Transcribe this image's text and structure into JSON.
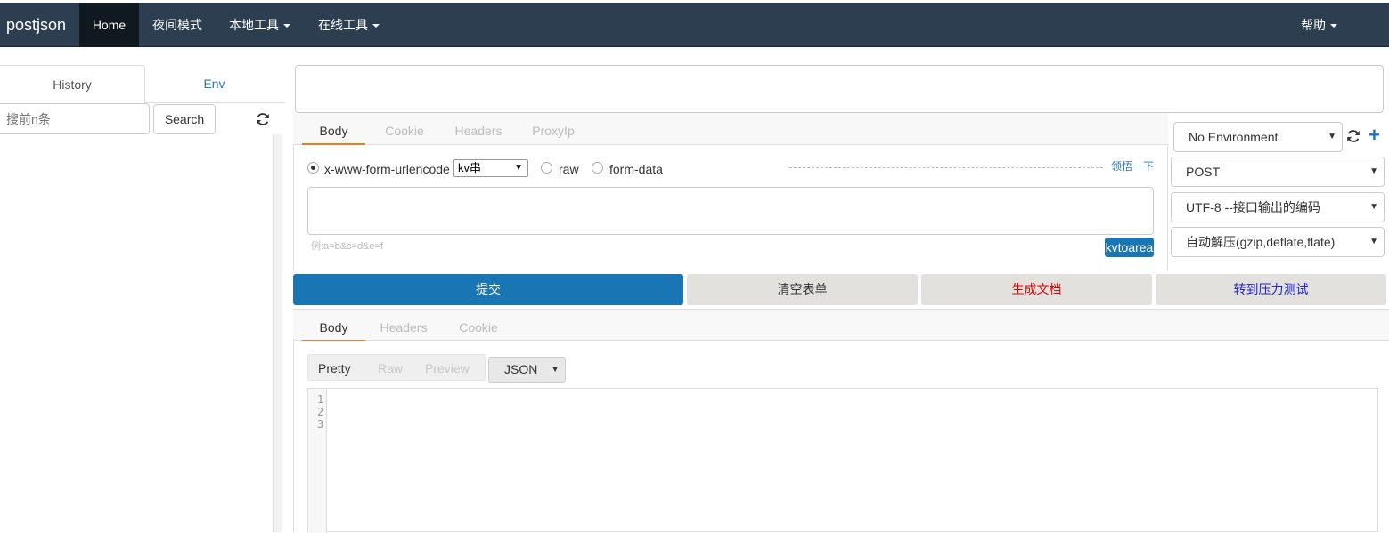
{
  "navbar": {
    "brand": "postjson",
    "items": [
      {
        "label": "Home"
      },
      {
        "label": "夜间模式"
      },
      {
        "label": "本地工具"
      },
      {
        "label": "在线工具"
      }
    ],
    "help": "帮助"
  },
  "left": {
    "tabs": [
      {
        "label": "History"
      },
      {
        "label": "Env"
      }
    ],
    "search_placeholder": "搜前n条",
    "search_button": "Search"
  },
  "request": {
    "tabs": [
      {
        "label": "Body"
      },
      {
        "label": "Cookie"
      },
      {
        "label": "Headers"
      },
      {
        "label": "ProxyIp"
      }
    ],
    "body_types": [
      {
        "label": "x-www-form-urlencode",
        "checked": true
      },
      {
        "label": "raw",
        "checked": false
      },
      {
        "label": "form-data",
        "checked": false
      }
    ],
    "kv_select": "kv串",
    "link": "领悟一下",
    "hint": "例:a=b&c=d&e=f",
    "kvtoarea": "kvtoarea"
  },
  "settings": {
    "environment": "No Environment",
    "method": "POST",
    "encoding": "UTF-8 --接口输出的编码",
    "decompress": "自动解压(gzip,deflate,flate)"
  },
  "actions": {
    "submit": "提交",
    "clear": "清空表单",
    "doc": "生成文档",
    "stress": "转到压力测试"
  },
  "response": {
    "tabs": [
      {
        "label": "Body"
      },
      {
        "label": "Headers"
      },
      {
        "label": "Cookie"
      }
    ],
    "views": [
      {
        "label": "Pretty"
      },
      {
        "label": "Raw"
      },
      {
        "label": "Preview"
      }
    ],
    "format": "JSON",
    "line_numbers": [
      "1",
      "2",
      "3"
    ]
  },
  "colors": {
    "navbar": "#2c3e50",
    "primary": "#1a75b5",
    "tab_accent": "#e67e22",
    "doc_text": "#e00000",
    "stress_text": "#2222cc"
  },
  "icons": {
    "refresh": "refresh-icon",
    "plus": "plus-icon",
    "caret": "caret-down-icon"
  }
}
